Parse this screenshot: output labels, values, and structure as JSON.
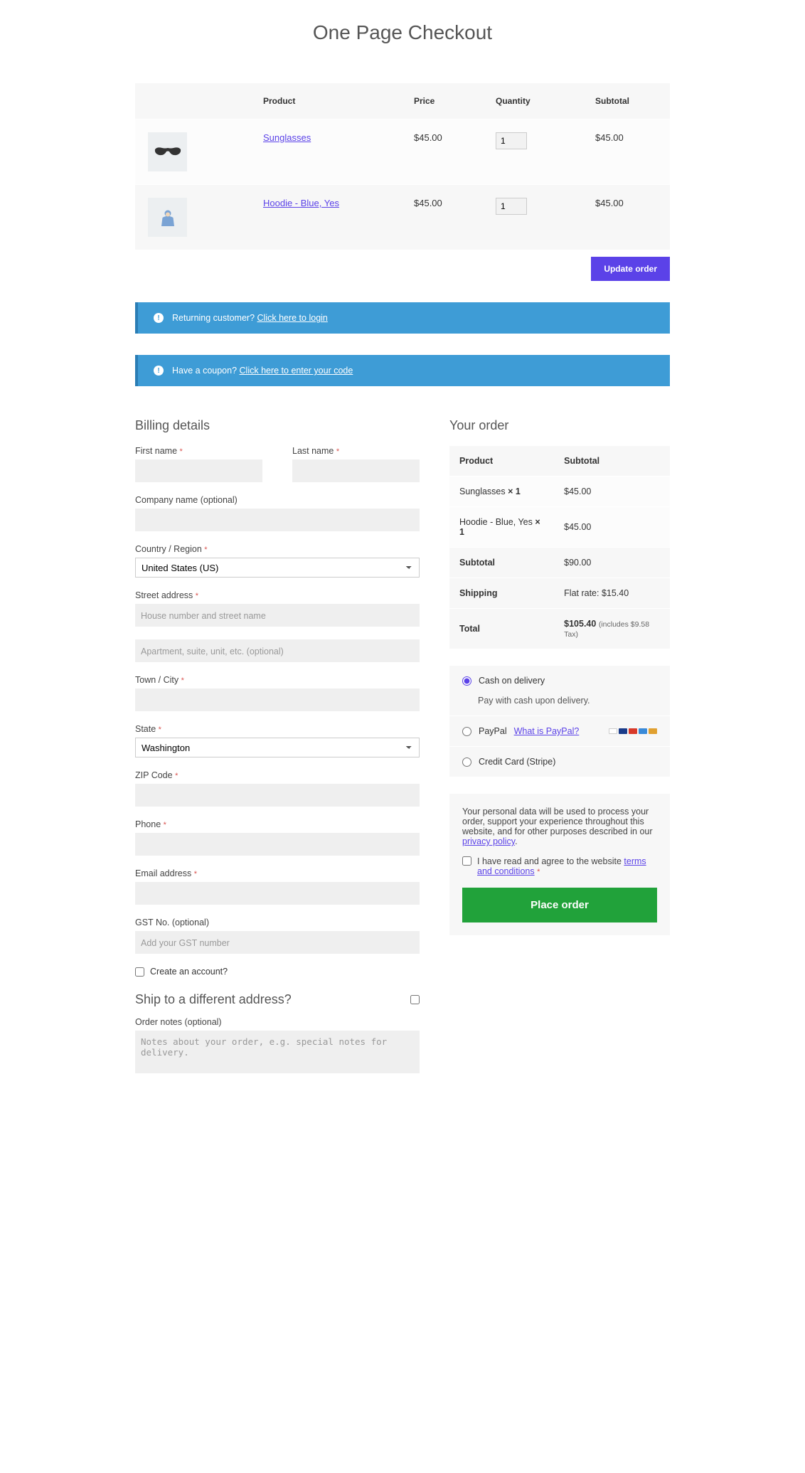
{
  "page_title": "One Page Checkout",
  "cart": {
    "headers": {
      "product": "Product",
      "price": "Price",
      "qty": "Quantity",
      "subtotal": "Subtotal"
    },
    "items": [
      {
        "name": "Sunglasses",
        "price": "$45.00",
        "qty": "1",
        "subtotal": "$45.00"
      },
      {
        "name": "Hoodie - Blue, Yes",
        "price": "$45.00",
        "qty": "1",
        "subtotal": "$45.00"
      }
    ],
    "update_label": "Update order"
  },
  "banners": {
    "login_prefix": "Returning customer? ",
    "login_link": "Click here to login",
    "coupon_prefix": "Have a coupon? ",
    "coupon_link": "Click here to enter your code"
  },
  "billing": {
    "heading": "Billing details",
    "first_name": "First name",
    "last_name": "Last name",
    "company": "Company name (optional)",
    "country": "Country / Region",
    "country_value": "United States (US)",
    "street": "Street address",
    "street_ph1": "House number and street name",
    "street_ph2": "Apartment, suite, unit, etc. (optional)",
    "city": "Town / City",
    "state": "State",
    "state_value": "Washington",
    "zip": "ZIP Code",
    "phone": "Phone",
    "email": "Email address",
    "gst": "GST No. (optional)",
    "gst_ph": "Add your GST number",
    "create_account": "Create an account?"
  },
  "ship": {
    "heading": "Ship to a different address?",
    "notes_label": "Order notes (optional)",
    "notes_ph": "Notes about your order, e.g. special notes for delivery."
  },
  "order": {
    "heading": "Your order",
    "hdr_product": "Product",
    "hdr_subtotal": "Subtotal",
    "lines": [
      {
        "name": "Sunglasses  ",
        "qty": "× 1",
        "subtotal": "$45.00"
      },
      {
        "name": "Hoodie - Blue, Yes  ",
        "qty": "× 1",
        "subtotal": "$45.00"
      }
    ],
    "subtotal_label": "Subtotal",
    "subtotal_value": "$90.00",
    "shipping_label": "Shipping",
    "shipping_value": "Flat rate: $15.40",
    "total_label": "Total",
    "total_value": "$105.40",
    "tax_note": "(includes $9.58 Tax)"
  },
  "payment": {
    "cod_label": "Cash on delivery",
    "cod_desc": "Pay with cash upon delivery.",
    "paypal_label": "PayPal",
    "paypal_what": "What is PayPal?",
    "stripe_label": "Credit Card (Stripe)"
  },
  "privacy": {
    "text": "Your personal data will be used to process your order, support your experience throughout this website, and for other purposes described in our ",
    "link": "privacy policy",
    "terms_text": "I have read and agree to the website ",
    "terms_link": "terms and conditions",
    "place_order": "Place order"
  }
}
